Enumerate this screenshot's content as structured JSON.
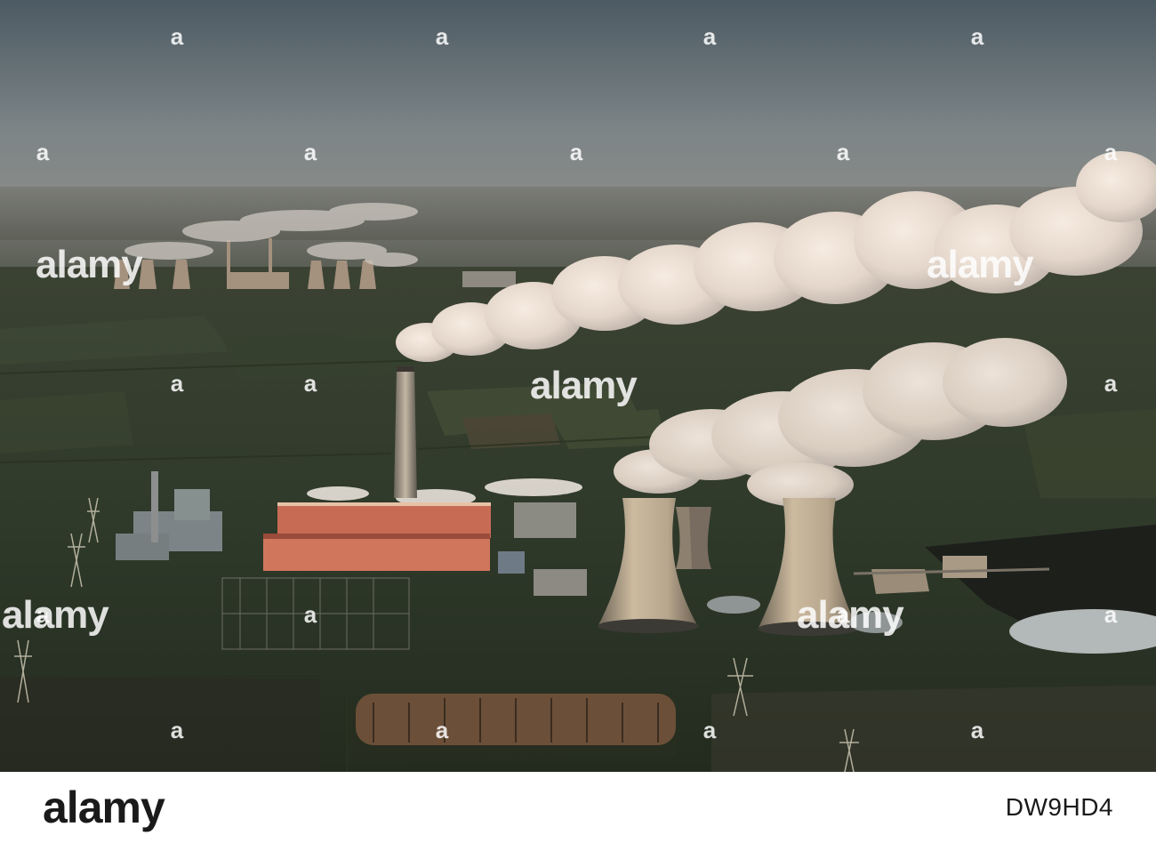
{
  "watermark": {
    "brand": "alamy"
  },
  "footer": {
    "logo_text": "alamy",
    "image_id": "DW9HD4"
  }
}
